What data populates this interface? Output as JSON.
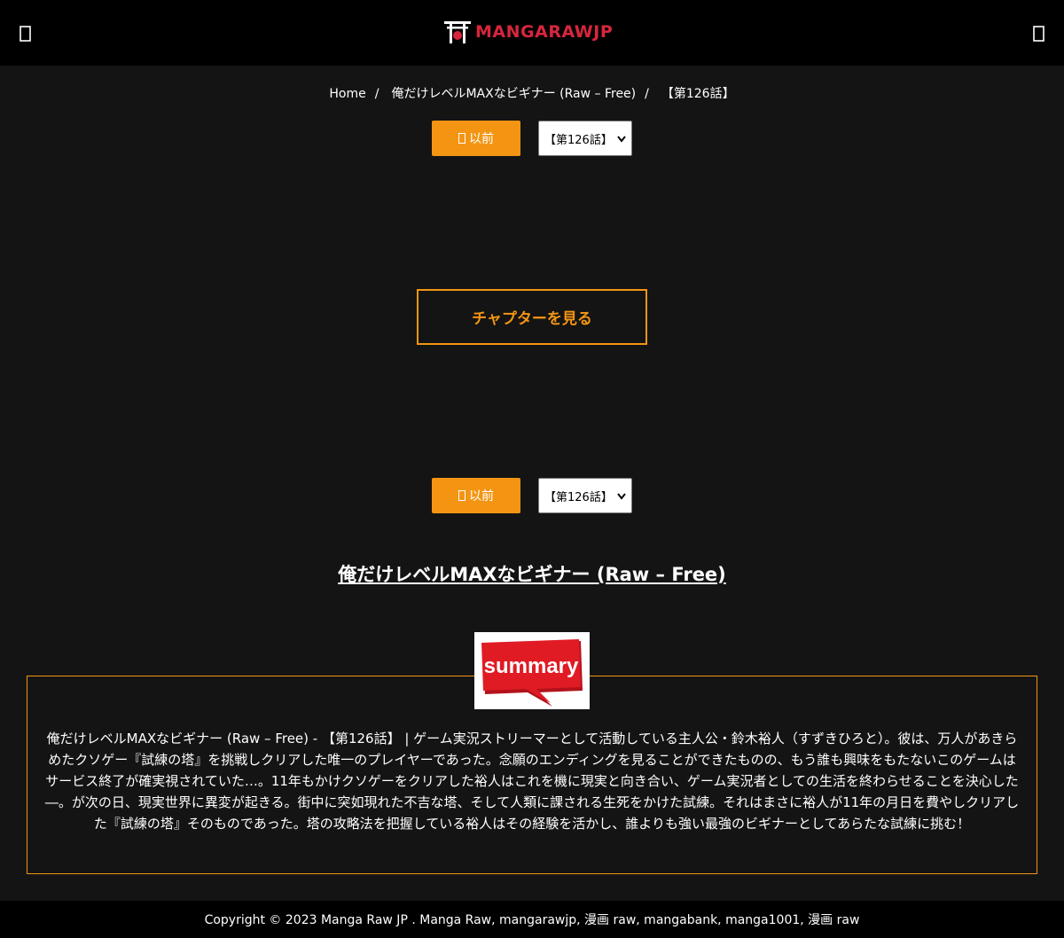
{
  "header": {
    "logo_text": "MANGARAWJP",
    "menu_icon": "menu-icon",
    "search_icon": "search-icon"
  },
  "breadcrumb": {
    "home": "Home",
    "series": "俺だけレベルMAXなビギナー (Raw – Free)",
    "current": "【第126話】",
    "separator": "/"
  },
  "nav_top": {
    "prev_label": "以前",
    "selected_chapter": "【第126話】"
  },
  "view_chapter_label": "チャプターを見る",
  "nav_bottom": {
    "prev_label": "以前",
    "selected_chapter": "【第126話】"
  },
  "series_title": "俺だけレベルMAXなビギナー (Raw – Free)",
  "summary": {
    "badge_text": "summary",
    "text": "俺だけレベルMAXなビギナー (Raw – Free) - 【第126話】 | ゲーム実況ストリーマーとして活動している主人公・鈴木裕人（すずきひろと）。彼は、万人があきらめたクソゲー『試練の塔』を挑戦しクリアした唯一のプレイヤーであった。念願のエンディングを見ることができたものの、もう誰も興味をもたないこのゲームはサービス終了が確実視されていた…。11年もかけクソゲーをクリアした裕人はこれを機に現実と向き合い、ゲーム実況者としての生活を終わらせることを決心した―。が次の日、現実世界に異変が起きる。街中に突如現れた不吉な塔、そして人類に課される生死をかけた試練。それはまさに裕人が11年の月日を費やしクリアした『試練の塔』そのものであった。塔の攻略法を把握している裕人はその経験を活かし、誰よりも強い最強のビギナーとしてあらたな試練に挑む！"
  },
  "footer": {
    "text": "Copyright © 2023 Manga Raw JP . Manga Raw, mangarawjp, 漫画 raw, mangabank, manga1001, 漫画 raw"
  },
  "colors": {
    "accent": "#f39513",
    "logo_red": "#d7263d",
    "background": "#141414",
    "header_bg": "#000000"
  }
}
